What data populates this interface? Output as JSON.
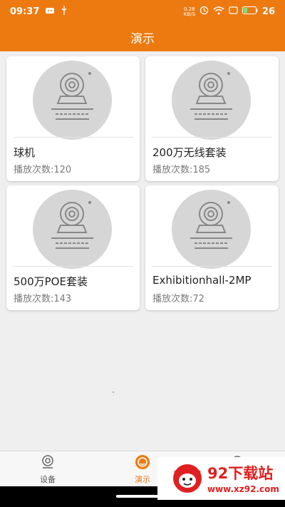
{
  "status_bar": {
    "time": "09:37",
    "net_rate_top": "0.28",
    "net_rate_bottom": "KB/S",
    "battery": "26"
  },
  "header": {
    "title": "演示"
  },
  "cards": [
    {
      "title": "球机",
      "count_label": "播放次数:",
      "count": "120"
    },
    {
      "title": "200万无线套装",
      "count_label": "播放次数:",
      "count": "185"
    },
    {
      "title": "500万POE套装",
      "count_label": "播放次数:",
      "count": "143"
    },
    {
      "title": "Exhibitionhall-2MP",
      "count_label": "播放次数:",
      "count": "72"
    }
  ],
  "bottom_nav": {
    "items": [
      {
        "label": "设备",
        "icon": "camera-icon"
      },
      {
        "label": "演示",
        "icon": "play-circle-icon",
        "active": true
      },
      {
        "label": "",
        "icon": "more-icon"
      }
    ]
  },
  "watermark": {
    "title": "92下载站",
    "url": "www.xz92.com"
  },
  "colors": {
    "accent": "#ed7a10",
    "background": "#efefef",
    "card": "#ffffff",
    "watermark_red": "#e02020"
  }
}
